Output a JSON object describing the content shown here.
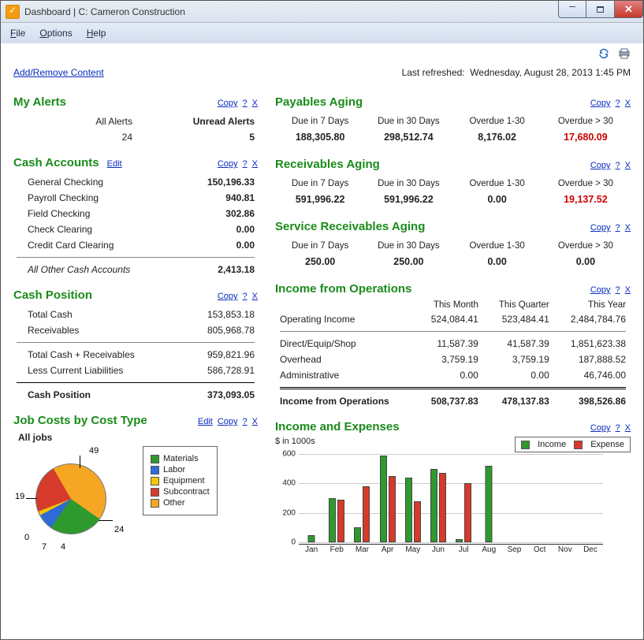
{
  "window_title": "Dashboard  |  C: Cameron Construction",
  "menu": {
    "file": "File",
    "options": "Options",
    "help": "Help"
  },
  "toolbar": {
    "refresh_tip": "Refresh",
    "print_tip": "Print"
  },
  "addremove": "Add/Remove Content",
  "last_refreshed_label": "Last refreshed:",
  "last_refreshed_value": "Wednesday, August 28, 2013  1:45 PM",
  "links": {
    "copy": "Copy",
    "help": "?",
    "close": "X",
    "edit": "Edit"
  },
  "my_alerts": {
    "title": "My Alerts",
    "all_label": "All Alerts",
    "all_value": "24",
    "unread_label": "Unread Alerts",
    "unread_value": "5"
  },
  "cash_accounts": {
    "title": "Cash Accounts",
    "rows": [
      {
        "label": "General Checking",
        "value": "150,196.33"
      },
      {
        "label": "Payroll Checking",
        "value": "940.81"
      },
      {
        "label": "Field Checking",
        "value": "302.86"
      },
      {
        "label": "Check Clearing",
        "value": "0.00"
      },
      {
        "label": "Credit Card Clearing",
        "value": "0.00"
      }
    ],
    "other_label": "All Other Cash Accounts",
    "other_value": "2,413.18"
  },
  "cash_position": {
    "title": "Cash Position",
    "rows": [
      {
        "label": "Total Cash",
        "value": "153,853.18"
      },
      {
        "label": "Receivables",
        "value": "805,968.78"
      },
      {
        "label": "Total Cash + Receivables",
        "value": "959,821.96"
      },
      {
        "label": "Less Current Liabilities",
        "value": "586,728.91"
      }
    ],
    "total_label": "Cash Position",
    "total_value": "373,093.05"
  },
  "payables": {
    "title": "Payables Aging",
    "headers": [
      "Due in 7 Days",
      "Due in 30 Days",
      "Overdue 1-30",
      "Overdue > 30"
    ],
    "values": [
      "188,305.80",
      "298,512.74",
      "8,176.02",
      "17,680.09"
    ]
  },
  "receivables": {
    "title": "Receivables Aging",
    "headers": [
      "Due in 7 Days",
      "Due in 30 Days",
      "Overdue 1-30",
      "Overdue > 30"
    ],
    "values": [
      "591,996.22",
      "591,996.22",
      "0.00",
      "19,137.52"
    ]
  },
  "service_rcv": {
    "title": "Service Receivables Aging",
    "headers": [
      "Due in 7 Days",
      "Due in 30 Days",
      "Overdue 1-30",
      "Overdue > 30"
    ],
    "values": [
      "250.00",
      "250.00",
      "0.00",
      "0.00"
    ]
  },
  "income_ops": {
    "title": "Income from Operations",
    "col_headers": [
      "",
      "This Month",
      "This Quarter",
      "This Year"
    ],
    "rows": [
      {
        "label": "Operating Income",
        "m": "524,084.41",
        "q": "523,484.41",
        "y": "2,484,784.76"
      },
      {
        "label": "Direct/Equip/Shop",
        "m": "11,587.39",
        "q": "41,587.39",
        "y": "1,851,623.38"
      },
      {
        "label": "Overhead",
        "m": "3,759.19",
        "q": "3,759.19",
        "y": "187,888.52"
      },
      {
        "label": "Administrative",
        "m": "0.00",
        "q": "0.00",
        "y": "46,746.00"
      }
    ],
    "total_label": "Income from Operations",
    "total": {
      "m": "508,737.83",
      "q": "478,137.83",
      "y": "398,526.86"
    }
  },
  "job_costs": {
    "title": "Job Costs by Cost Type",
    "subtitle": "All jobs",
    "legend": [
      "Materials",
      "Labor",
      "Equipment",
      "Subcontract",
      "Other"
    ],
    "colors": [
      "#2e9a2e",
      "#2e6bd6",
      "#f5c400",
      "#d63a2a",
      "#f5a623"
    ],
    "callouts": {
      "top": "49",
      "right": "24",
      "bl1": "4",
      "bl2": "7",
      "bl3": "0",
      "left": "19"
    }
  },
  "inc_exp": {
    "title": "Income and Expenses",
    "ylabel": "$ in 1000s",
    "legend": {
      "income": "Income",
      "expense": "Expense"
    }
  },
  "chart_data": [
    {
      "type": "pie",
      "title": "Job Costs by Cost Type — All jobs",
      "categories": [
        "Materials",
        "Labor",
        "Equipment",
        "Subcontract",
        "Other"
      ],
      "values": [
        24,
        7,
        0,
        19,
        49
      ],
      "note": "An additional slice labeled 4 is shown between the 7 and 0 callouts but has no matching legend entry"
    },
    {
      "type": "bar",
      "title": "Income and Expenses",
      "ylabel": "$ in 1000s",
      "ylim": [
        0,
        600
      ],
      "yticks": [
        0,
        200,
        400,
        600
      ],
      "categories": [
        "Jan",
        "Feb",
        "Mar",
        "Apr",
        "May",
        "Jun",
        "Jul",
        "Aug",
        "Sep",
        "Oct",
        "Nov",
        "Dec"
      ],
      "series": [
        {
          "name": "Income",
          "color": "#2e9a2e",
          "values": [
            50,
            300,
            100,
            590,
            440,
            500,
            20,
            520,
            0,
            0,
            0,
            0
          ]
        },
        {
          "name": "Expense",
          "color": "#d63a2a",
          "values": [
            0,
            290,
            380,
            450,
            280,
            470,
            400,
            0,
            0,
            0,
            0,
            0
          ]
        }
      ]
    }
  ]
}
